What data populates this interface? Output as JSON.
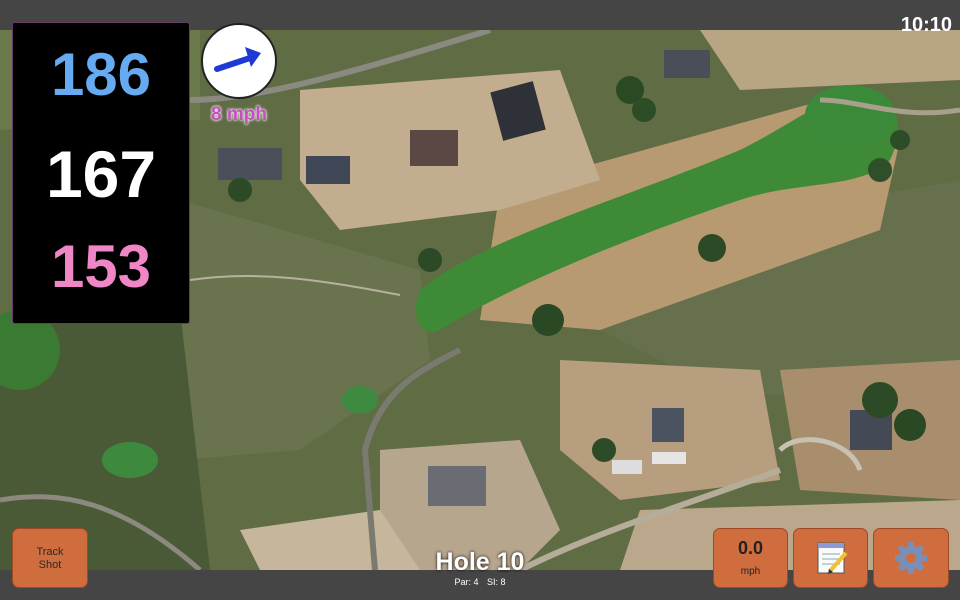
{
  "status": {
    "time": "10:10"
  },
  "yardage": {
    "back": "186",
    "middle": "167",
    "front": "153"
  },
  "wind": {
    "speed": "8 mph",
    "icon": "wind-arrow-icon"
  },
  "hole": {
    "title": "Hole 10",
    "par": "Par: 4",
    "stroke_index": "SI: 8"
  },
  "buttons": {
    "track_shot_line1": "Track",
    "track_shot_line2": "Shot",
    "speed_value": "0.0",
    "speed_unit": "mph",
    "notes_icon": "notepad-icon",
    "settings_icon": "gear-icon"
  },
  "colors": {
    "back_yardage": "#66aaf2",
    "middle_yardage": "#ffffff",
    "front_yardage": "#ef86c6",
    "wind_text": "#c64fbf",
    "button": "#d06d3e"
  }
}
